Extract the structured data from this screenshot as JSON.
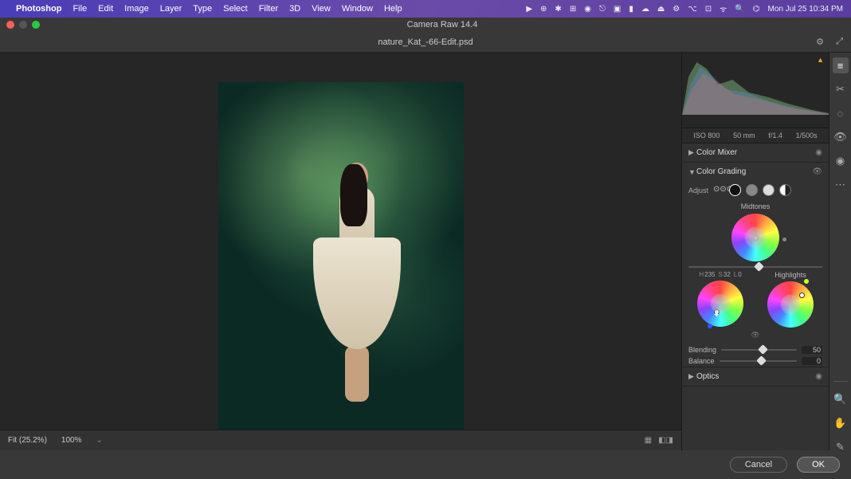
{
  "menubar": {
    "app": "Photoshop",
    "items": [
      "File",
      "Edit",
      "Image",
      "Layer",
      "Type",
      "Select",
      "Filter",
      "3D",
      "View",
      "Window",
      "Help"
    ],
    "datetime": "Mon Jul 25  10:34 PM"
  },
  "window": {
    "title": "Camera Raw 14.4",
    "filename": "nature_Kat_-66-Edit.psd"
  },
  "exif": {
    "iso": "ISO 800",
    "focal": "50 mm",
    "aperture": "f/1.4",
    "shutter": "1/500s"
  },
  "sections": {
    "color_mixer": "Color Mixer",
    "color_grading": "Color Grading",
    "optics": "Optics"
  },
  "color_grading": {
    "adjust_label": "Adjust",
    "midtones_label": "Midtones",
    "highlights_label": "Highlights",
    "shadows_hsl": {
      "h": "235",
      "s": "32",
      "l": "0"
    },
    "blending": {
      "label": "Blending",
      "value": "50"
    },
    "balance": {
      "label": "Balance",
      "value": "0"
    }
  },
  "footer": {
    "fit": "Fit (25.2%)",
    "zoom": "100%"
  },
  "buttons": {
    "cancel": "Cancel",
    "ok": "OK"
  }
}
